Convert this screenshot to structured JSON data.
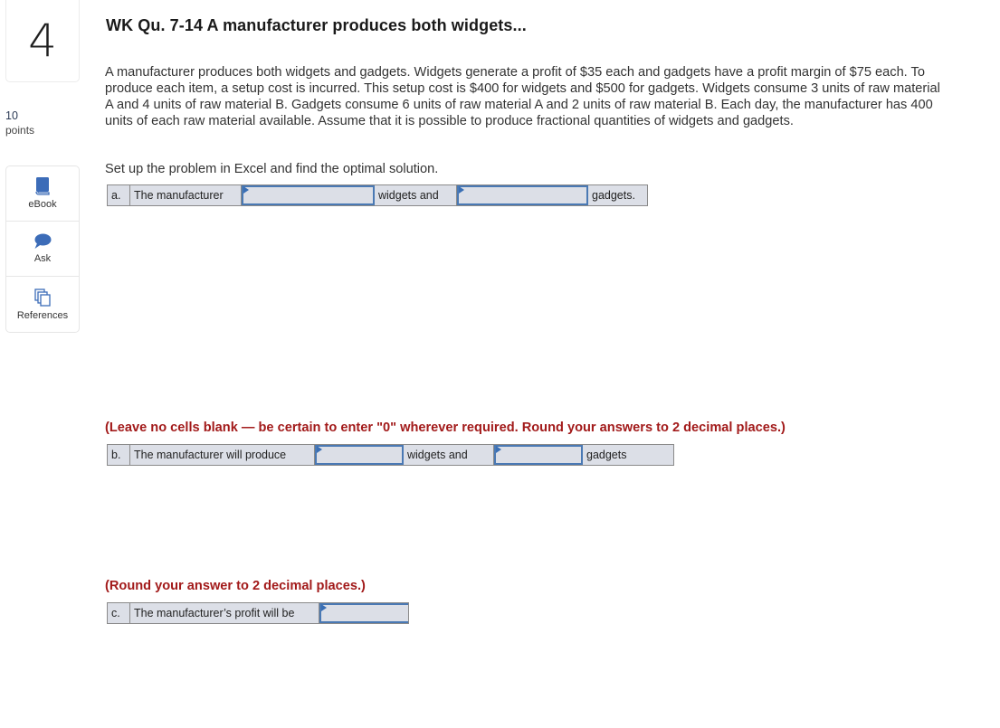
{
  "question": {
    "number": "4",
    "points_value": "10",
    "points_label": "points",
    "title": "WK Qu. 7-14 A manufacturer produces both widgets...",
    "body": "A manufacturer produces both widgets and gadgets. Widgets generate a profit of $35 each and gadgets have a profit margin of $75 each. To produce each item, a setup cost is incurred. This setup cost is $400 for widgets and $500 for gadgets. Widgets consume 3 units of raw material A and 4 units of raw material B. Gadgets consume 6 units of raw material A and 2 units of raw material B. Each day, the manufacturer has 400 units of each raw material available. Assume that it is possible to produce fractional quantities of widgets and gadgets.",
    "instruction": "Set up the problem in Excel and find the optimal solution."
  },
  "tools": [
    {
      "label": "eBook",
      "icon": "book-icon"
    },
    {
      "label": "Ask",
      "icon": "speech-bubble-icon"
    },
    {
      "label": "References",
      "icon": "documents-icon"
    }
  ],
  "part_a": {
    "letter": "a.",
    "lead": "The manufacturer",
    "input1_value": "",
    "mid": "widgets and",
    "input2_value": "",
    "tail": "gadgets."
  },
  "note_b": "(Leave no cells blank — be certain to enter \"0\" wherever required. Round your answers to 2 decimal places.)",
  "part_b": {
    "letter": "b.",
    "lead": "The manufacturer will produce",
    "input1_value": "",
    "mid": "widgets and",
    "input2_value": "",
    "tail": "gadgets"
  },
  "note_c": "(Round your answer to 2 decimal places.)",
  "part_c": {
    "letter": "c.",
    "lead": "The manufacturer’s profit will be",
    "input1_value": ""
  },
  "colors": {
    "accent_blue": "#3a6fb5",
    "note_red": "#a21a1a",
    "cell_bg": "#dcdfe7"
  }
}
